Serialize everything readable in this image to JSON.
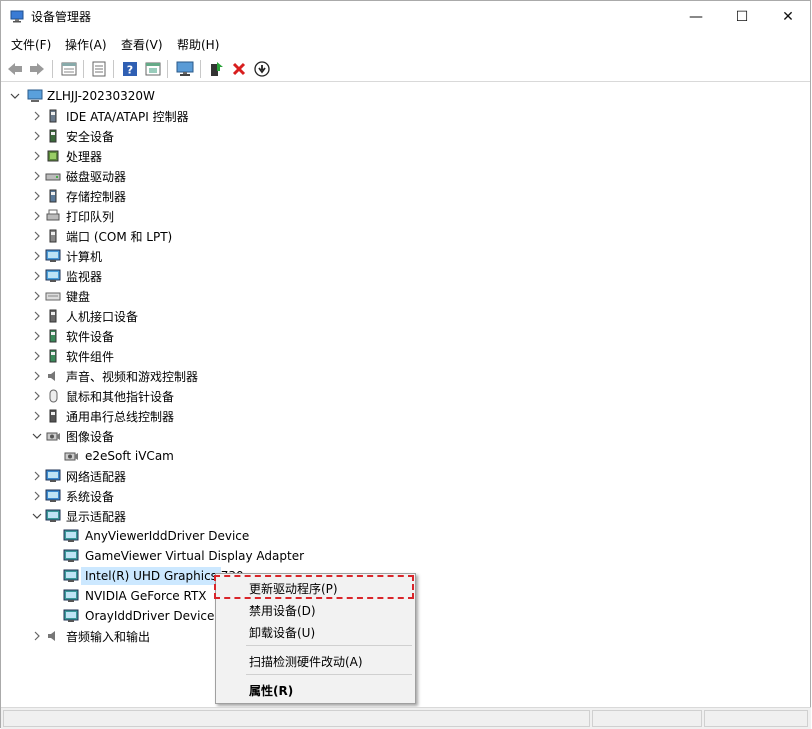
{
  "window": {
    "title": "设备管理器",
    "controls": {
      "minimize": "—",
      "maximize": "☐",
      "close": "✕"
    }
  },
  "menubar": [
    "文件(F)",
    "操作(A)",
    "查看(V)",
    "帮助(H)"
  ],
  "toolbar": [
    "back-arrow-icon",
    "forward-arrow-icon",
    "properties-icon",
    "view-list-icon",
    "help-icon",
    "action-pane-icon",
    "monitor-icon",
    "update-driver-icon",
    "uninstall-x-icon",
    "download-icon"
  ],
  "tree": {
    "root": "ZLHJJ-20230320W",
    "items": [
      {
        "label": "IDE ATA/ATAPI 控制器",
        "icon": "ide-controller-icon"
      },
      {
        "label": "安全设备",
        "icon": "security-device-icon"
      },
      {
        "label": "处理器",
        "icon": "processor-icon"
      },
      {
        "label": "磁盘驱动器",
        "icon": "disk-drive-icon"
      },
      {
        "label": "存储控制器",
        "icon": "storage-controller-icon"
      },
      {
        "label": "打印队列",
        "icon": "printer-icon"
      },
      {
        "label": "端口 (COM 和 LPT)",
        "icon": "port-icon"
      },
      {
        "label": "计算机",
        "icon": "computer-icon"
      },
      {
        "label": "监视器",
        "icon": "monitor-icon"
      },
      {
        "label": "键盘",
        "icon": "keyboard-icon"
      },
      {
        "label": "人机接口设备",
        "icon": "hid-icon"
      },
      {
        "label": "软件设备",
        "icon": "software-device-icon"
      },
      {
        "label": "软件组件",
        "icon": "software-component-icon"
      },
      {
        "label": "声音、视频和游戏控制器",
        "icon": "speaker-icon"
      },
      {
        "label": "鼠标和其他指针设备",
        "icon": "mouse-icon"
      },
      {
        "label": "通用串行总线控制器",
        "icon": "usb-icon"
      },
      {
        "label": "图像设备",
        "icon": "camera-icon",
        "expanded": true
      },
      {
        "label": "e2eSoft iVCam",
        "icon": "camera-icon",
        "child": true
      },
      {
        "label": "网络适配器",
        "icon": "network-adapter-icon"
      },
      {
        "label": "系统设备",
        "icon": "system-device-icon"
      },
      {
        "label": "显示适配器",
        "icon": "display-adapter-icon",
        "expanded": true
      },
      {
        "label": "AnyViewerIddDriver Device",
        "icon": "display-adapter-icon",
        "child": true
      },
      {
        "label": "GameViewer Virtual Display Adapter",
        "icon": "display-adapter-icon",
        "child": true
      },
      {
        "label": "Intel(R) UHD Graphics 730",
        "icon": "display-adapter-icon",
        "child": true,
        "selected": true
      },
      {
        "label": "NVIDIA GeForce RTX",
        "icon": "display-adapter-icon",
        "child": true
      },
      {
        "label": "OrayIddDriver Device",
        "icon": "display-adapter-icon",
        "child": true
      },
      {
        "label": "音频输入和输出",
        "icon": "audio-io-icon"
      }
    ]
  },
  "context_menu": {
    "items": [
      {
        "label": "更新驱动程序(P)",
        "highlighted": true
      },
      {
        "label": "禁用设备(D)"
      },
      {
        "label": "卸载设备(U)"
      },
      {
        "separator": true
      },
      {
        "label": "扫描检测硬件改动(A)"
      },
      {
        "separator": true
      },
      {
        "label": "属性(R)",
        "bold": true
      }
    ]
  },
  "colors": {
    "highlight_border": "#d9262b",
    "selection_bg": "#cce8ff",
    "menu_bg": "#f2f2f2"
  }
}
